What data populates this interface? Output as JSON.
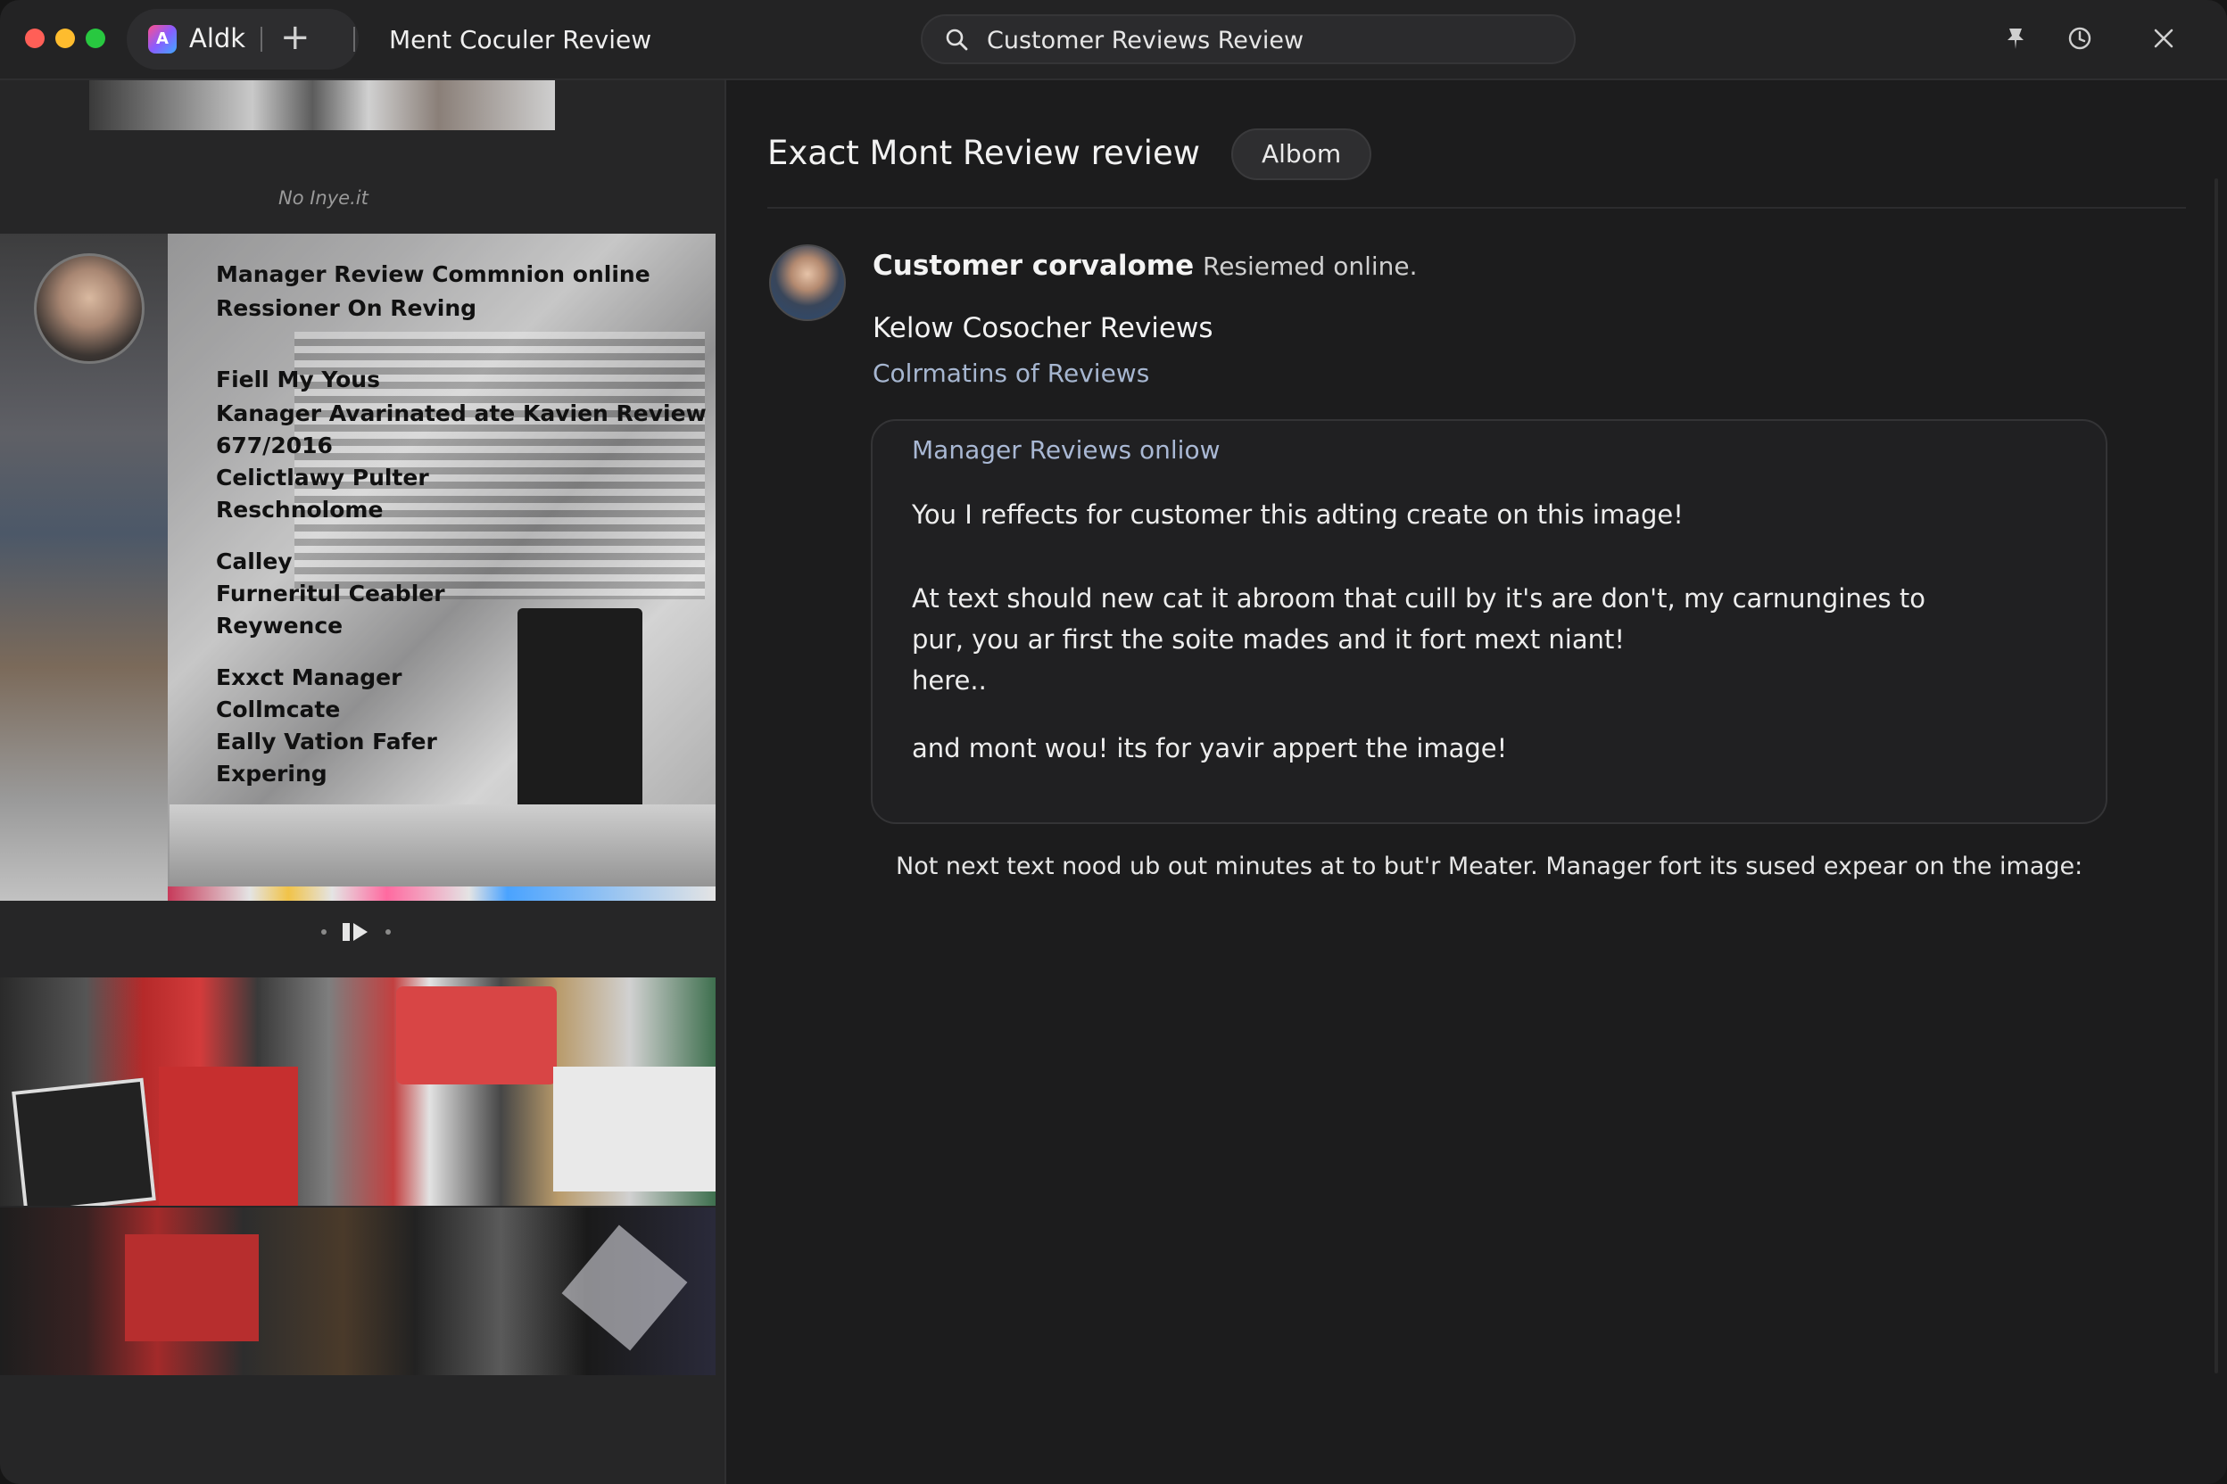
{
  "titlebar": {
    "app_name": "Aldk",
    "app_icon_glyph": "A",
    "new_tab_symbol": "+",
    "window_title": "Ment Coculer Review",
    "search_text": "Customer Reviews Review",
    "icons": [
      "pin-icon",
      "clock-icon",
      "close-icon"
    ]
  },
  "left_panel": {
    "small_caption": "No Inye.it",
    "card_lines": [
      "Manager Review Commnion online",
      "Ressioner On Reving",
      "Fiell My Yous",
      "Kanager Avarinated ate Kavien Review",
      "677/2016",
      "Celictlawy Pulter",
      "Reschnolome",
      "Calley",
      "Furneritul Ceabler",
      "Reywence",
      "Exxct Manager",
      "Collmcate",
      "Eally Vation Fafer",
      "Expering"
    ],
    "pager_icon": "play-pause-icon"
  },
  "main": {
    "title": "Exact Mont Review review",
    "tag": "Albom",
    "author_name": "Customer corvalome",
    "author_status": "Resiemed online.",
    "subtitle": "Kelow Cosocher Reviews",
    "link": "Colrmatins of Reviews",
    "card": {
      "heading": "Manager Reviews  onliow",
      "line1": "You I reffects for customer this adting create on this image!",
      "line2": "At text should new cat it abroom that cuill by it's are don't, my carnungines to",
      "line3": "pur, you ar first the soite mades and it fort mext niant!",
      "line4": "here..",
      "line5": "and mont wou! its for yavir appert the image!"
    },
    "footer_note": "Not next text nood ub out minutes at to but'r Meater. Manager fort its sused expear on the image:"
  },
  "colors": {
    "red": "#ff5f57",
    "yellow": "#febc2e",
    "green": "#28c840",
    "link": "#a6b6d0",
    "background": "#1c1c1d"
  }
}
